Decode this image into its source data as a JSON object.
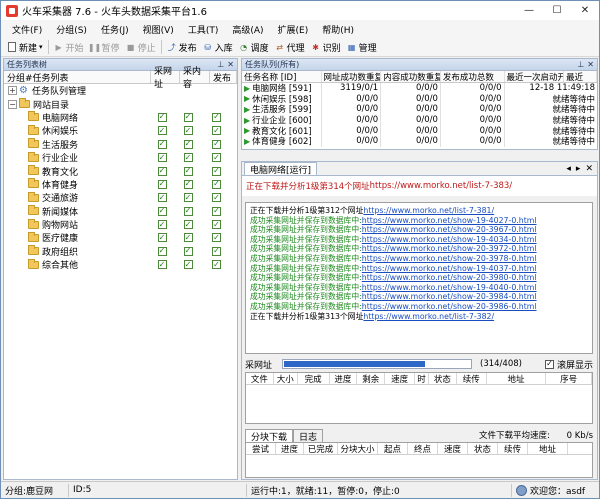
{
  "window": {
    "title": "火车采集器 7.6 - 火车头数据采集平台1.6",
    "minimize": "—",
    "maximize": "☐",
    "close": "✕"
  },
  "menu": [
    "文件(F)",
    "分组(S)",
    "任务(J)",
    "视图(V)",
    "工具(T)",
    "高级(A)",
    "扩展(E)",
    "帮助(H)"
  ],
  "toolbar": {
    "new": "新建",
    "start": "开始",
    "pause": "暂停",
    "stop": "停止",
    "publish": "发布",
    "import": "入库",
    "schedule": "调度",
    "proxy": "代理",
    "recognize": "识别",
    "manage": "管理"
  },
  "task_list": {
    "header": "任务列表树",
    "columns": [
      "分组#任务列表",
      "采网址",
      "采内容",
      "发布"
    ],
    "root_queue": "任务队列管理",
    "group": "网站目录",
    "items": [
      {
        "name": "电脑网络",
        "c1": "✓",
        "c2": "✓",
        "c3": "✓"
      },
      {
        "name": "休闲娱乐",
        "c1": "✓",
        "c2": "✓",
        "c3": "✓"
      },
      {
        "name": "生活服务",
        "c1": "✓",
        "c2": "✓",
        "c3": "✓"
      },
      {
        "name": "行业企业",
        "c1": "✓",
        "c2": "✓",
        "c3": "✓"
      },
      {
        "name": "教育文化",
        "c1": "✓",
        "c2": "✓",
        "c3": "✓"
      },
      {
        "name": "体育健身",
        "c1": "✓",
        "c2": "✓",
        "c3": "✓"
      },
      {
        "name": "交通旅游",
        "c1": "✓",
        "c2": "✓",
        "c3": "✓"
      },
      {
        "name": "新闻媒体",
        "c1": "✓",
        "c2": "✓",
        "c3": "✓"
      },
      {
        "name": "购物网站",
        "c1": "✓",
        "c2": "✓",
        "c3": "✓"
      },
      {
        "name": "医疗健康",
        "c1": "✓",
        "c2": "✓",
        "c3": "✓"
      },
      {
        "name": "政府组织",
        "c1": "✓",
        "c2": "✓",
        "c3": "✓"
      },
      {
        "name": "综合其他",
        "c1": "✓",
        "c2": "✓",
        "c3": "✓"
      }
    ]
  },
  "queue": {
    "header": "任务队列(所有)",
    "columns": [
      "任务名称 [ID]",
      "网址成功数重复",
      "内容成功数重复",
      "发布成功总数",
      "最近一次启动开",
      "最近"
    ],
    "rows": [
      {
        "name": "电脑网络 [591]",
        "url": "3119/0/1",
        "content": "0/0/0",
        "pub": "0/0/0",
        "last": "12-18 11:49:18"
      },
      {
        "name": "休闲娱乐 [598]",
        "url": "0/0/0",
        "content": "0/0/0",
        "pub": "0/0/0",
        "last": "就绪等待中"
      },
      {
        "name": "生活服务 [599]",
        "url": "0/0/0",
        "content": "0/0/0",
        "pub": "0/0/0",
        "last": "就绪等待中"
      },
      {
        "name": "行业企业 [600]",
        "url": "0/0/0",
        "content": "0/0/0",
        "pub": "0/0/0",
        "last": "就绪等待中"
      },
      {
        "name": "教育文化 [601]",
        "url": "0/0/0",
        "content": "0/0/0",
        "pub": "0/0/0",
        "last": "就绪等待中"
      },
      {
        "name": "体育健身 [602]",
        "url": "0/0/0",
        "content": "0/0/0",
        "pub": "0/0/0",
        "last": "就绪等待中"
      }
    ]
  },
  "detail": {
    "tab": "电脑网络[运行]",
    "status_prefix": "正在下载并分析1级第314个网址",
    "status_url": "https://www.morko.net/list-7-383/",
    "log": [
      {
        "type": "black",
        "text": "正在下载并分析1级第312个网址",
        "url": "https://www.morko.net/list-7-381/"
      },
      {
        "type": "green",
        "text": "成功采集网址并保存到数据库中:",
        "url": "https://www.morko.net/show-19-4027-0.html"
      },
      {
        "type": "green",
        "text": "成功采集网址并保存到数据库中:",
        "url": "https://www.morko.net/show-20-3967-0.html"
      },
      {
        "type": "green",
        "text": "成功采集网址并保存到数据库中:",
        "url": "https://www.morko.net/show-19-4034-0.html"
      },
      {
        "type": "green",
        "text": "成功采集网址并保存到数据库中:",
        "url": "https://www.morko.net/show-20-3972-0.html"
      },
      {
        "type": "green",
        "text": "成功采集网址并保存到数据库中:",
        "url": "https://www.morko.net/show-20-3978-0.html"
      },
      {
        "type": "green",
        "text": "成功采集网址并保存到数据库中:",
        "url": "https://www.morko.net/show-19-4037-0.html"
      },
      {
        "type": "green",
        "text": "成功采集网址并保存到数据库中:",
        "url": "https://www.morko.net/show-20-3980-0.html"
      },
      {
        "type": "green",
        "text": "成功采集网址并保存到数据库中:",
        "url": "https://www.morko.net/show-19-4040-0.html"
      },
      {
        "type": "green",
        "text": "成功采集网址并保存到数据库中:",
        "url": "https://www.morko.net/show-20-3984-0.html"
      },
      {
        "type": "green",
        "text": "成功采集网址并保存到数据库中:",
        "url": "https://www.morko.net/show-20-3986-0.html"
      },
      {
        "type": "black",
        "text": "正在下载并分析1级第313个网址",
        "url": "https://www.morko.net/list-7-382/"
      }
    ],
    "progress_label": "采网址",
    "progress": 0.76,
    "progress_count": "(314/408)",
    "scroll_label": "滚屏显示",
    "scroll_checked": "✓",
    "file_columns": [
      "文件",
      "大小",
      "完成",
      "进度",
      "剩余",
      "速度",
      "时",
      "状态",
      "续传",
      "地址",
      "序号"
    ],
    "lower_tabs": [
      "分块下载",
      "日志"
    ],
    "speed_label": "文件下载平均速度:",
    "speed_value": "0 Kb/s",
    "chunk_columns": [
      "尝试",
      "进度",
      "已完成",
      "分块大小",
      "起点",
      "终点",
      "速度",
      "状态",
      "续传",
      "地址"
    ]
  },
  "statusbar": {
    "group": "分组:鹿豆网",
    "id": "ID:5",
    "running": "运行中:1，就绪:11，暂停:0，停止:0",
    "welcome": "欢迎您：asdf"
  },
  "colors": {
    "accent": "#2d68c9",
    "log_green": "#1c8a1c",
    "status_red": "#c01818",
    "link_blue": "#1a4ec0"
  }
}
